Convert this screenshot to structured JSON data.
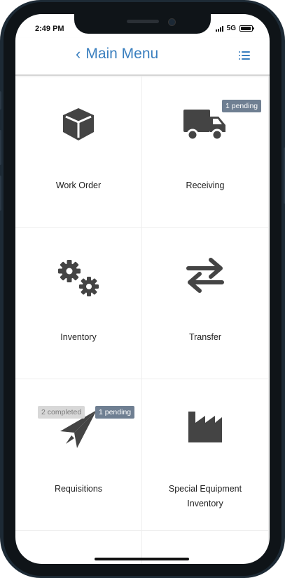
{
  "status": {
    "time": "2:49 PM",
    "network": "5G"
  },
  "header": {
    "title": "Main Menu"
  },
  "tiles": [
    {
      "label": "Work Order",
      "icon": "cube-icon"
    },
    {
      "label": "Receiving",
      "icon": "truck-icon",
      "pending": "1 pending"
    },
    {
      "label": "Inventory",
      "icon": "gears-icon"
    },
    {
      "label": "Transfer",
      "icon": "arrows-exchange-icon"
    },
    {
      "label": "Requisitions",
      "icon": "paper-plane-icon",
      "completed": "2 completed",
      "pending": "1 pending"
    },
    {
      "label": "Special Equipment Inventory",
      "icon": "factory-icon"
    }
  ],
  "colors": {
    "accent": "#3a7fbf",
    "icon": "#444444",
    "badge_pending": "#6f7f92",
    "badge_completed": "#d8d8d8"
  }
}
